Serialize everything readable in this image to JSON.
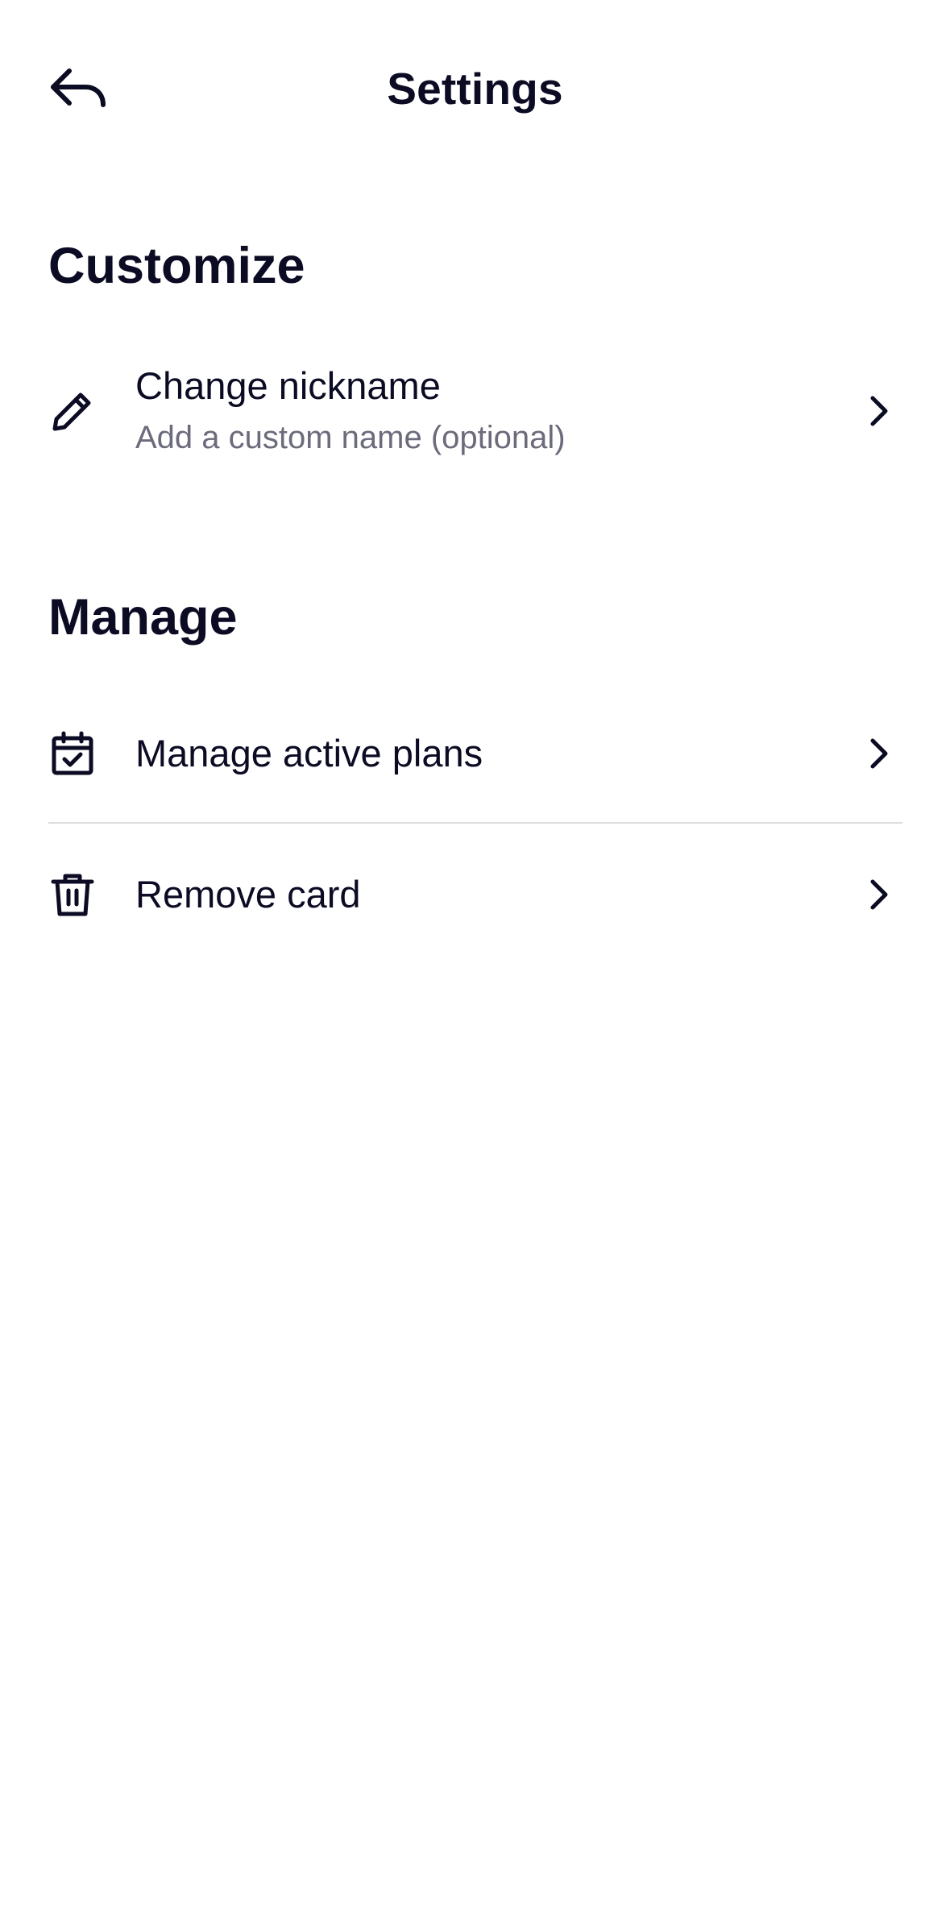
{
  "header": {
    "title": "Settings",
    "back_icon": "back-arrow-icon"
  },
  "customize": {
    "title": "Customize",
    "items": [
      {
        "label": "Change nickname",
        "sublabel": "Add a custom name (optional)",
        "icon": "pencil-icon"
      }
    ]
  },
  "manage": {
    "title": "Manage",
    "items": [
      {
        "label": "Manage active plans",
        "icon": "calendar-check-icon"
      },
      {
        "label": "Remove card",
        "icon": "trash-icon"
      }
    ]
  },
  "colors": {
    "text_primary": "#0b0b24",
    "text_secondary": "#6b6b7b",
    "divider": "#dcdce0",
    "background": "#ffffff"
  }
}
